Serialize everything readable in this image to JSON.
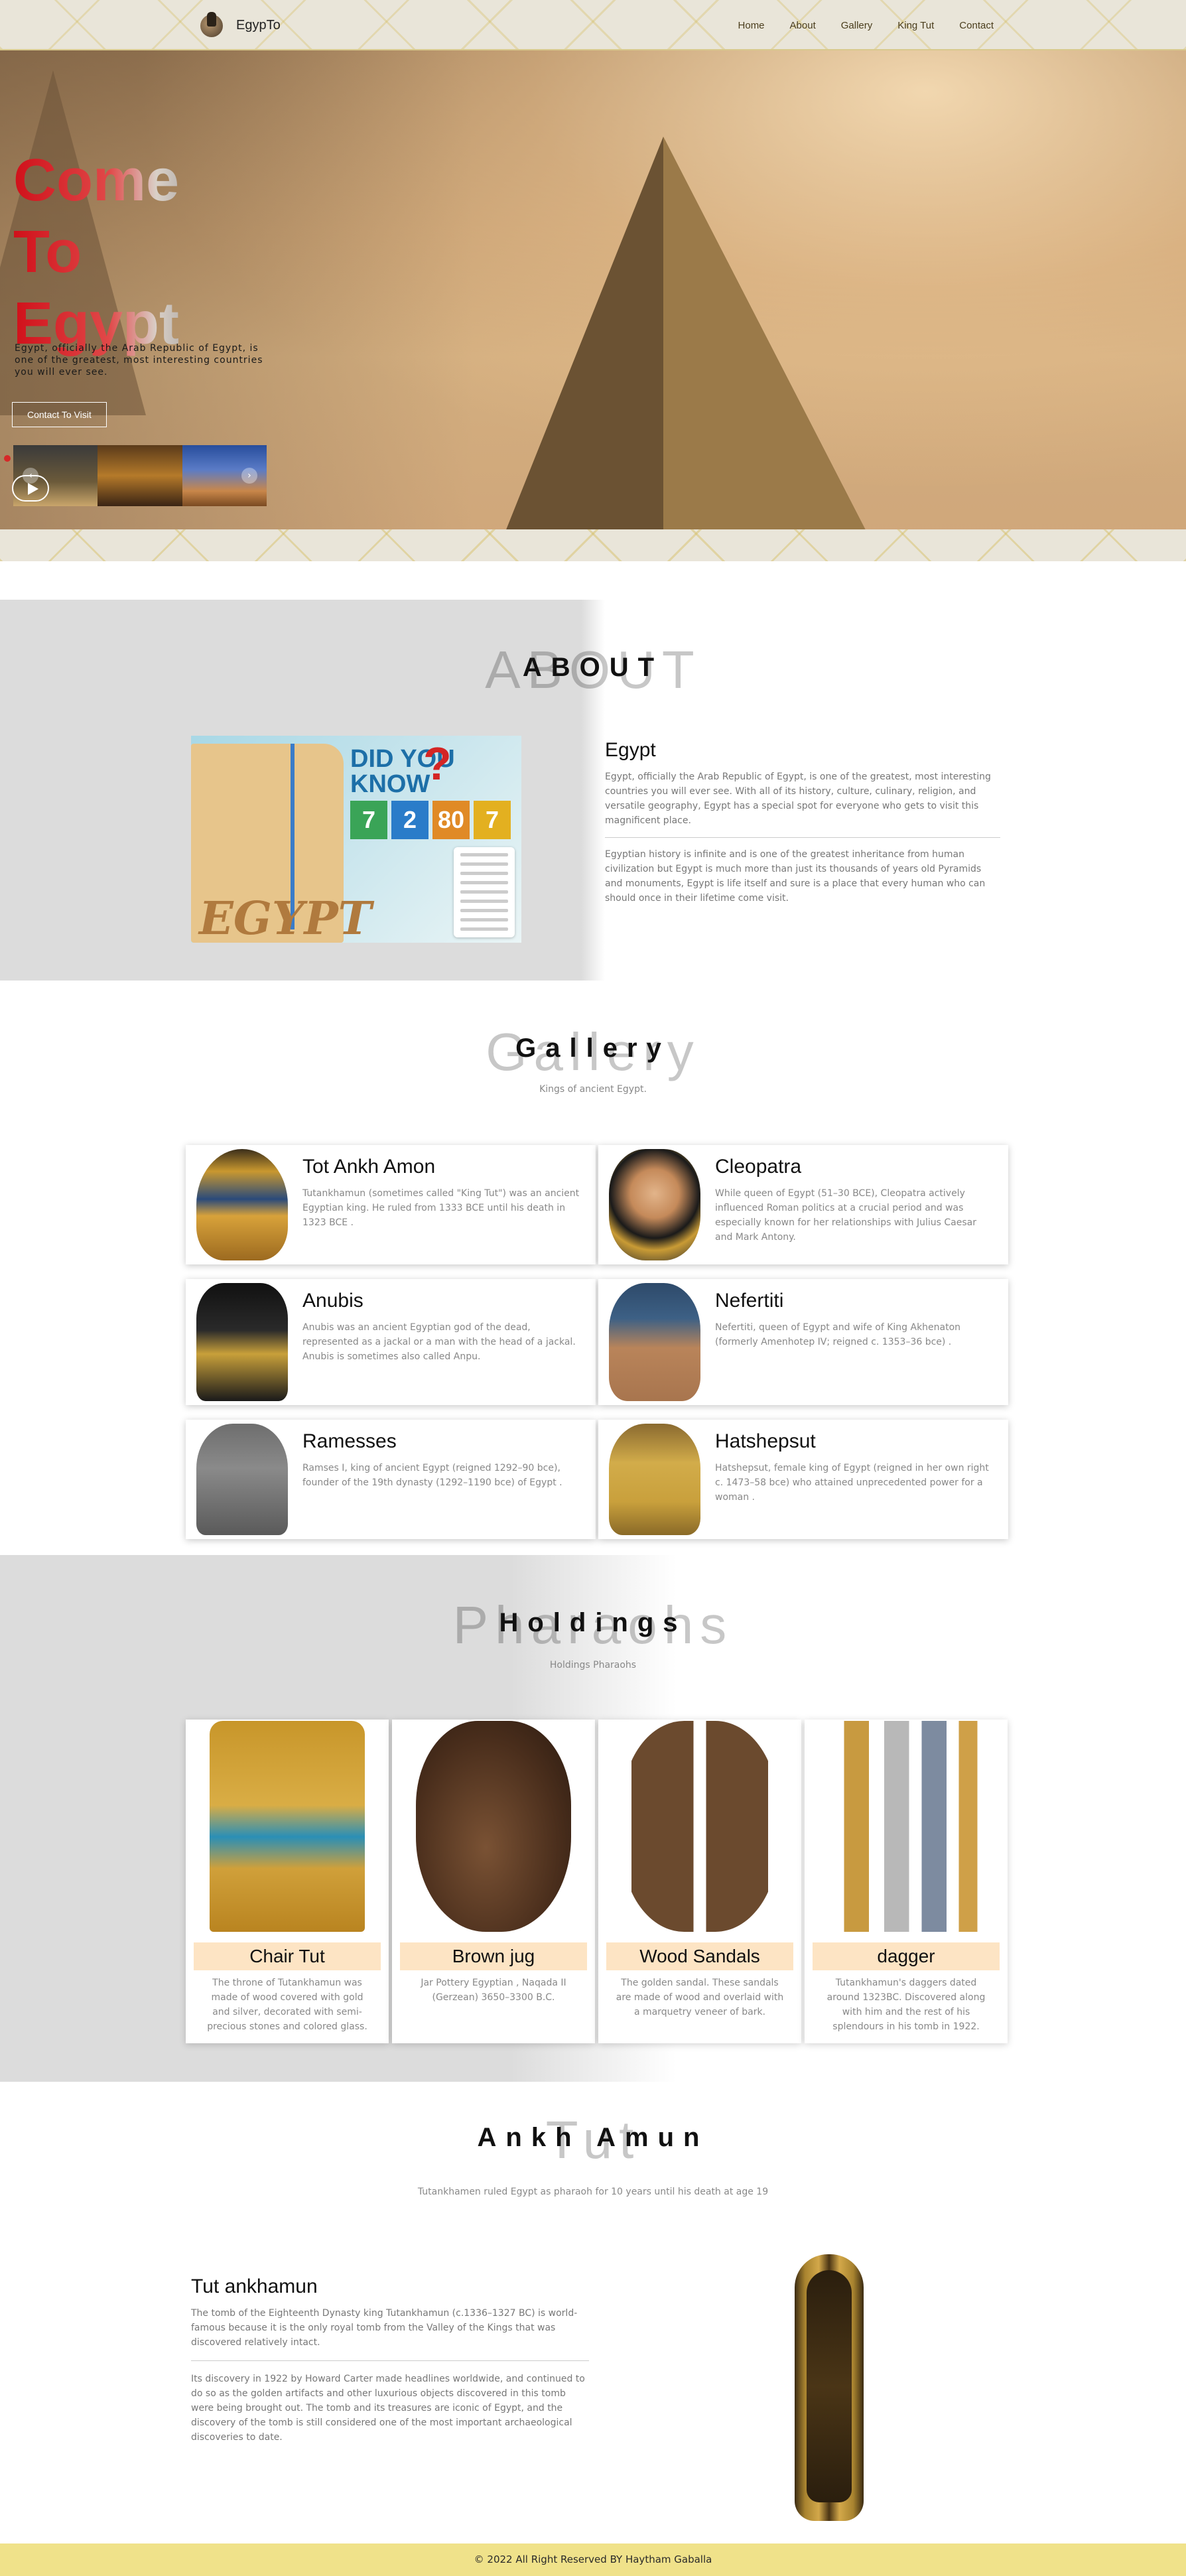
{
  "nav": {
    "brand": "EgypTo",
    "links": [
      "Home",
      "About",
      "Gallery",
      "King Tut",
      "Contact"
    ]
  },
  "hero": {
    "title_line1": "Come To",
    "title_line2": "Egypt",
    "description": "Egypt, officially the Arab Republic of Egypt, is one of the greatest, most interesting countries you will ever see.",
    "button": "Contact To Visit",
    "prev_arrow": "‹",
    "next_arrow": "›"
  },
  "about": {
    "ghost_title": "ABOUT",
    "title": "ABOUT",
    "image_text": {
      "country": "EGYPT",
      "did_you": "DID YOU",
      "know": "KNOW",
      "question": "?",
      "numbers": [
        "7",
        "2",
        "80",
        "7"
      ],
      "number_colors": [
        "#3aa457",
        "#2a7cc9",
        "#e08a26",
        "#e3b020"
      ]
    },
    "heading": "Egypt",
    "paragraph1": "Egypt, officially the Arab Republic of Egypt, is one of the greatest, most interesting countries you will ever see. With all of its history, culture, culinary, religion, and versatile geography, Egypt has a special spot for everyone who gets to visit this magnificent place.",
    "paragraph2": "Egyptian history is infinite and is one of the greatest inheritance from human civilization but Egypt is much more than just its thousands of years old Pyramids and monuments, Egypt is life itself and sure is a place that every human who can should once in their lifetime come visit."
  },
  "gallery": {
    "ghost_title": "Gallery",
    "title": "Gallery",
    "subtitle": "Kings of ancient Egypt.",
    "cards": [
      {
        "name": "Tot Ankh Amon",
        "text": "Tutankhamun (sometimes called \"King Tut\") was an ancient Egyptian king. He ruled from 1333 BCE until his death in 1323 BCE ."
      },
      {
        "name": "Cleopatra",
        "text": "While queen of Egypt (51–30 BCE), Cleopatra actively influenced Roman politics at a crucial period and was especially known for her relationships with Julius Caesar and Mark Antony."
      },
      {
        "name": "Anubis",
        "text": "Anubis was an ancient Egyptian god of the dead, represented as a jackal or a man with the head of a jackal. Anubis is sometimes also called Anpu."
      },
      {
        "name": "Nefertiti",
        "text": "Nefertiti, queen of Egypt and wife of King Akhenaton (formerly Amenhotep IV; reigned c. 1353–36 bce) ."
      },
      {
        "name": "Ramesses",
        "text": "Ramses I, king of ancient Egypt (reigned 1292–90 bce), founder of the 19th dynasty (1292–1190 bce) of Egypt ."
      },
      {
        "name": "Hatshepsut",
        "text": "Hatshepsut, female king of Egypt (reigned in her own right c. 1473–58 bce) who attained unprecedented power for a woman ."
      }
    ]
  },
  "holdings": {
    "ghost_title": "Pharaohs",
    "title": "Holdings",
    "subtitle": "Holdings Pharaohs",
    "items": [
      {
        "name": "Chair Tut",
        "text": "The throne of Tutankhamun was made of wood covered with gold and silver, decorated with semi-precious stones and colored glass."
      },
      {
        "name": "Brown jug",
        "text": "Jar Pottery Egyptian , Naqada II (Gerzean) 3650–3300 B.C."
      },
      {
        "name": "Wood Sandals",
        "text": "The golden sandal. These sandals are made of wood and overlaid with a marquetry veneer of bark."
      },
      {
        "name": "dagger",
        "text": "Tutankhamun's daggers dated around 1323BC. Discovered along with him and the rest of his splendours in his tomb in 1922."
      }
    ]
  },
  "tut": {
    "ghost_title": "Tut",
    "title": "Ankh Amun",
    "subtitle": "Tutankhamen ruled Egypt as pharaoh for 10 years until his death at age 19",
    "heading": "Tut ankhamun",
    "paragraph1": "The tomb of the Eighteenth Dynasty king Tutankhamun (c.1336–1327 BC) is world-famous because it is the only royal tomb from the Valley of the Kings that was discovered relatively intact.",
    "paragraph2": "Its discovery in 1922 by Howard Carter made headlines worldwide, and continued to do so as the golden artifacts and other luxurious objects discovered in this tomb were being brought out. The tomb and its treasures are iconic of Egypt, and the discovery of the tomb is still considered one of the most important archaeological discoveries to date."
  },
  "footer": {
    "text": "© 2022 All Right Reserved BY Haytham Gaballa"
  }
}
